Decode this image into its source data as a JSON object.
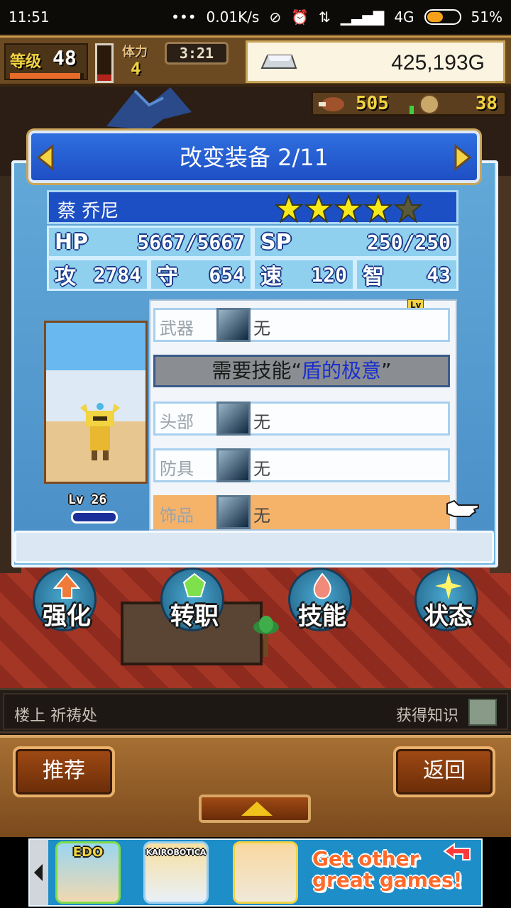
{
  "statusbar": {
    "time": "11:51",
    "network_speed": "0.01K/s",
    "network_type": "4G",
    "battery": "51%",
    "battery_level": 0.51,
    "icons": [
      "more-dots-icon",
      "mute-icon",
      "alarm-icon",
      "data-transfer-icon",
      "signal-icon"
    ]
  },
  "hud": {
    "level_label": "等级",
    "level_value": "48",
    "level_progress": 0.95,
    "stamina_label": "体力",
    "stamina_value": "4",
    "stamina_level": 0.18,
    "timer": "3:21",
    "gold": "425,193G",
    "food": "505",
    "medals": "38"
  },
  "panel": {
    "title": "改变装备 2/11",
    "character": {
      "name": "蔡 乔尼",
      "stars_filled": 4,
      "stars_total": 5,
      "level": "Lv 26"
    },
    "stats": {
      "hp_label": "HP",
      "hp_value": "5667/5667",
      "sp_label": "SP",
      "sp_value": "250/250",
      "atk_label": "攻",
      "atk_value": "2784",
      "def_label": "守",
      "def_value": "654",
      "spd_label": "速",
      "spd_value": "120",
      "int_label": "智",
      "int_value": "43"
    },
    "lv_tag": "Lv",
    "equipment": [
      {
        "label": "武器",
        "value": "无"
      },
      {
        "label": "头部",
        "value": "无"
      },
      {
        "label": "防具",
        "value": "无"
      },
      {
        "label": "饰品",
        "value": "无"
      }
    ],
    "requirement": {
      "prefix": "需要技能“",
      "skill": "盾的极意",
      "suffix": "”"
    }
  },
  "actions": [
    {
      "label": "强化",
      "icon": "arrow-up-icon"
    },
    {
      "label": "转职",
      "icon": "green-crystal-icon"
    },
    {
      "label": "技能",
      "icon": "flame-icon"
    },
    {
      "label": "状态",
      "icon": "sparkle-icon"
    }
  ],
  "location": {
    "text": "楼上 祈祷处",
    "knowledge": "获得知识"
  },
  "menu": {
    "recommend": "推荐",
    "back": "返回"
  },
  "ad": {
    "app1": "EDO",
    "app2": "KAIROBOTICA",
    "cta_line1": "Get other",
    "cta_line2": "great games!"
  },
  "colors": {
    "panel_blue": "#6fb5e0",
    "title_blue": "#1f4fc4",
    "selected_row": "#f5b36a",
    "skill_text": "#1a2ed0",
    "gold_text": "#f2d341"
  }
}
